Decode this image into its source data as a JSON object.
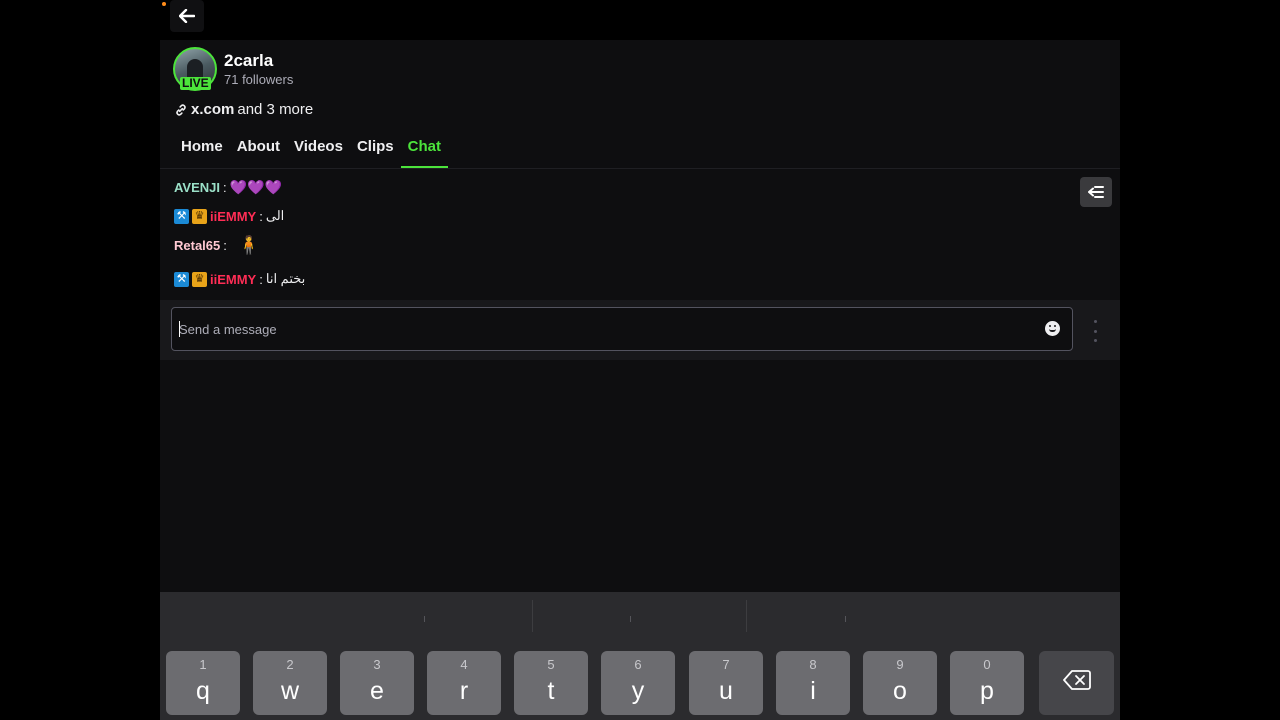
{
  "channel": {
    "name": "2carla",
    "followers": "71 followers",
    "live_badge": "LIVE",
    "links_primary": "x.com",
    "links_secondary": "and 3 more"
  },
  "tabs": [
    {
      "label": "Home"
    },
    {
      "label": "About"
    },
    {
      "label": "Videos"
    },
    {
      "label": "Clips"
    },
    {
      "label": "Chat",
      "active": true
    }
  ],
  "chat": {
    "messages": [
      {
        "user": "AVENJI",
        "user_color": "#9be0c8",
        "text": "💜💜💜",
        "badges": []
      },
      {
        "user": "iiEMMY",
        "user_color": "#ff2d55",
        "text": "الى",
        "badges": [
          "mod",
          "vip"
        ]
      },
      {
        "user": "Retal65",
        "user_color": "#ffc8d2",
        "text": "🧍",
        "badges": []
      },
      {
        "user": "iiEMMY",
        "user_color": "#ff2d55",
        "text": "بختم انا",
        "badges": [
          "mod",
          "vip"
        ]
      }
    ]
  },
  "composer": {
    "placeholder": "Send a message"
  },
  "keyboard": {
    "keys": [
      {
        "num": "1",
        "ch": "q"
      },
      {
        "num": "2",
        "ch": "w"
      },
      {
        "num": "3",
        "ch": "e"
      },
      {
        "num": "4",
        "ch": "r"
      },
      {
        "num": "5",
        "ch": "t"
      },
      {
        "num": "6",
        "ch": "y"
      },
      {
        "num": "7",
        "ch": "u"
      },
      {
        "num": "8",
        "ch": "i"
      },
      {
        "num": "9",
        "ch": "o"
      },
      {
        "num": "0",
        "ch": "p"
      }
    ],
    "delete_icon": "backspace-icon"
  },
  "colors": {
    "accent": "#4ce43b",
    "background": "#0e0e10"
  }
}
